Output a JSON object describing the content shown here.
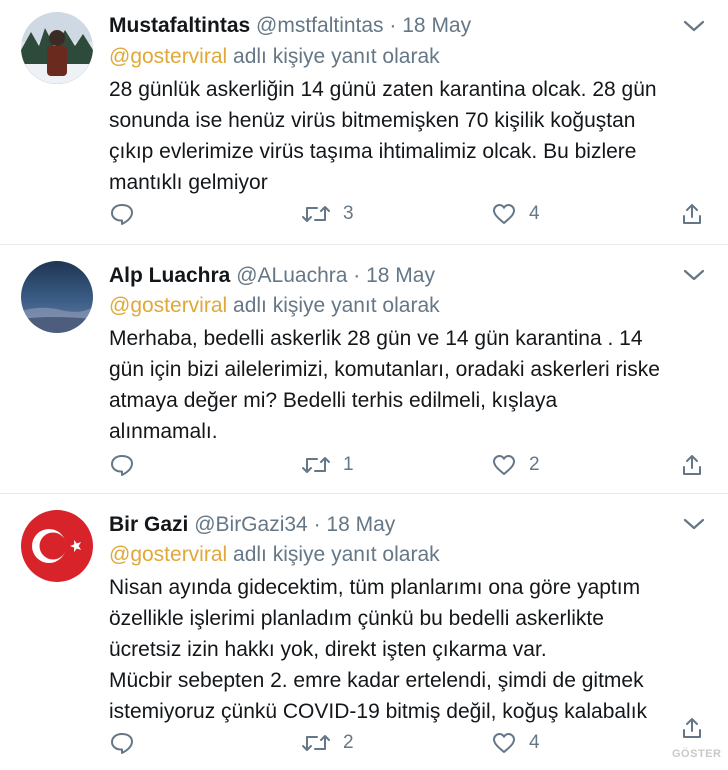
{
  "tweets": [
    {
      "display_name": "Mustafaltintas",
      "handle": "@mstfaltintas",
      "separator": "·",
      "date": "18 May",
      "mention": "@gosterviral",
      "reply_suffix": "adlı kişiye yanıt olarak",
      "text": "28 günlük askerliğin 14 günü zaten karantina olcak. 28 gün\nsonunda ise henüz virüs bitmemişken 70 kişilik koğuştan\nçıkıp evlerimize virüs taşıma ihtimalimiz olcak. Bu bizlere\nmantıklı gelmiyor",
      "retweets": "3",
      "likes": "4"
    },
    {
      "display_name": "Alp Luachra",
      "handle": "@ALuachra",
      "separator": "·",
      "date": "18 May",
      "mention": "@gosterviral",
      "reply_suffix": "adlı kişiye yanıt olarak",
      "text": "Merhaba, bedelli askerlik 28 gün ve 14 gün karantina . 14\ngün için bizi ailelerimizi, komutanları, oradaki askerleri riske\natmaya değer mi? Bedelli terhis edilmeli, kışlaya\nalınmamalı.",
      "retweets": "1",
      "likes": "2"
    },
    {
      "display_name": "Bir Gazi",
      "handle": "@BirGazi34",
      "separator": "·",
      "date": "18 May",
      "mention": "@gosterviral",
      "reply_suffix": "adlı kişiye yanıt olarak",
      "text": "Nisan ayında gidecektim, tüm planlarımı ona göre yaptım\nözellikle işlerimi planladım çünkü bu bedelli askerlikte\nücretsiz izin hakkı yok, direkt işten çıkarma var.\nMücbir sebepten 2. emre kadar ertelendi, şimdi de gitmek\nistemiyoruz çünkü COVID-19 bitmiş değil, koğuş kalabalık",
      "retweets": "2",
      "likes": "4"
    }
  ],
  "watermark": "GÖSTER",
  "colors": {
    "mention": "#e0a839",
    "secondary_text": "#657786",
    "divider": "#e6ecf0"
  }
}
